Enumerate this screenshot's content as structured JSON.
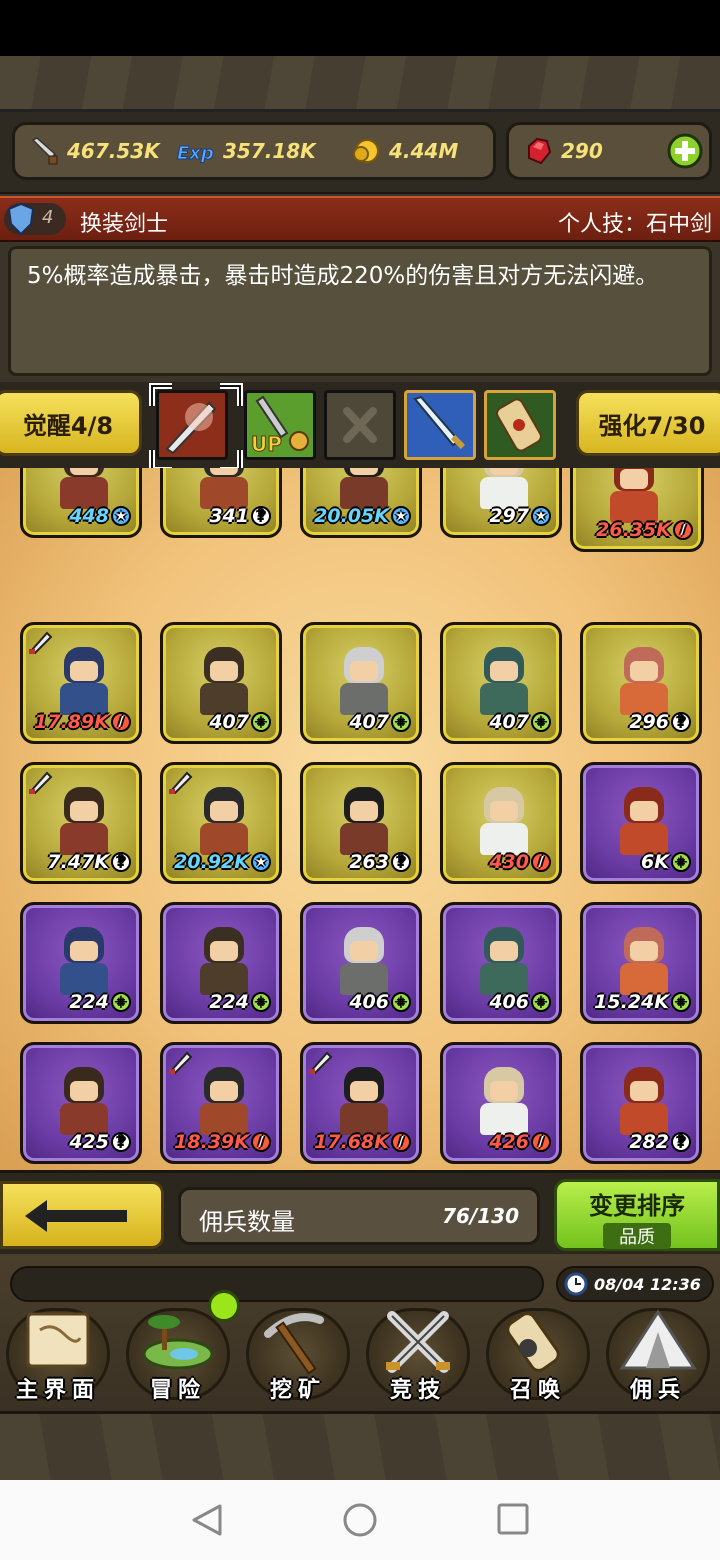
{
  "currency": {
    "attack": "467.53K",
    "exp": "357.18K",
    "gold": "4.44M",
    "gems": "290",
    "icons": [
      "sword-icon",
      "exp-icon",
      "gold-coin-icon",
      "ruby-icon",
      "add-icon"
    ]
  },
  "hero": {
    "level": "4",
    "name": "换装剑士",
    "skill": "个人技：石中剑",
    "description": "5%概率造成暴击，暴击时造成220%的伤害且对方无法闪避。"
  },
  "awaken": {
    "label": "觉醒4/8"
  },
  "enhance": {
    "label": "强化7/30"
  },
  "grid": {
    "rows": [
      [
        {
          "value": "448",
          "badge": "s",
          "color": "cyan",
          "rarity": "gold"
        },
        {
          "value": "341",
          "badge": "q",
          "color": "white",
          "rarity": "gold"
        },
        {
          "value": "20.05K",
          "badge": "s",
          "color": "cyan",
          "rarity": "gold"
        },
        {
          "value": "297",
          "badge": "s",
          "color": "white",
          "rarity": "gold"
        },
        {
          "value": "26.35K",
          "badge": "x",
          "color": "red",
          "rarity": "gold"
        }
      ],
      [
        {
          "value": "17.89K",
          "badge": "x",
          "color": "red",
          "rarity": "gold",
          "sword": true
        },
        {
          "value": "407",
          "badge": "p",
          "color": "white",
          "rarity": "gold"
        },
        {
          "value": "407",
          "badge": "p",
          "color": "white",
          "rarity": "gold"
        },
        {
          "value": "407",
          "badge": "p",
          "color": "white",
          "rarity": "gold"
        },
        {
          "value": "296",
          "badge": "q",
          "color": "white",
          "rarity": "gold"
        }
      ],
      [
        {
          "value": "7.47K",
          "badge": "q",
          "color": "white",
          "rarity": "gold",
          "sword": true
        },
        {
          "value": "20.92K",
          "badge": "s",
          "color": "cyan",
          "rarity": "gold",
          "sword": true
        },
        {
          "value": "263",
          "badge": "q",
          "color": "white",
          "rarity": "gold"
        },
        {
          "value": "430",
          "badge": "x",
          "color": "red",
          "rarity": "gold"
        },
        {
          "value": "6K",
          "badge": "p",
          "color": "white",
          "rarity": "purple"
        }
      ],
      [
        {
          "value": "224",
          "badge": "p",
          "color": "white",
          "rarity": "purple"
        },
        {
          "value": "224",
          "badge": "p",
          "color": "white",
          "rarity": "purple"
        },
        {
          "value": "406",
          "badge": "p",
          "color": "white",
          "rarity": "purple"
        },
        {
          "value": "406",
          "badge": "p",
          "color": "white",
          "rarity": "purple"
        },
        {
          "value": "15.24K",
          "badge": "p",
          "color": "white",
          "rarity": "purple"
        }
      ],
      [
        {
          "value": "425",
          "badge": "q",
          "color": "white",
          "rarity": "purple"
        },
        {
          "value": "18.39K",
          "badge": "x",
          "color": "red",
          "rarity": "purple",
          "sword": true
        },
        {
          "value": "17.68K",
          "badge": "x",
          "color": "red",
          "rarity": "purple",
          "sword": true
        },
        {
          "value": "426",
          "badge": "x",
          "color": "red",
          "rarity": "purple"
        },
        {
          "value": "282",
          "badge": "q",
          "color": "white",
          "rarity": "purple"
        }
      ]
    ]
  },
  "roster": {
    "count_label": "佣兵数量",
    "count": "76/130",
    "sort_label": "变更排序",
    "sort_mode": "品质"
  },
  "clock": "08/04 12:36",
  "nav": [
    {
      "label": "主界面",
      "icon": "map-scroll-icon"
    },
    {
      "label": "冒险",
      "icon": "island-icon"
    },
    {
      "label": "挖矿",
      "icon": "pickaxe-icon"
    },
    {
      "label": "竞技",
      "icon": "crossed-swords-icon"
    },
    {
      "label": "召唤",
      "icon": "summon-scroll-icon"
    },
    {
      "label": "佣兵",
      "icon": "tent-icon"
    }
  ],
  "colors": {
    "gold_text": "#f7e27a",
    "title_band": "#8c2d1a",
    "card_gold": "#b6a83a",
    "card_purple": "#6b3ca5",
    "sort_green": "#8bd12c"
  }
}
